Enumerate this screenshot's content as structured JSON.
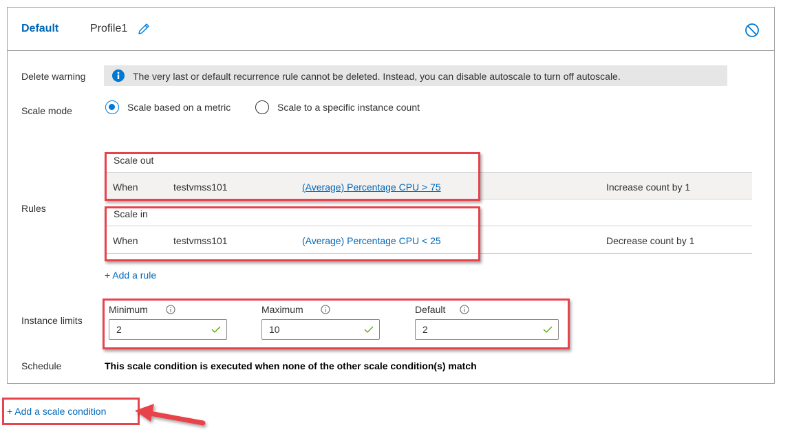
{
  "header": {
    "tab_default": "Default",
    "profile_name": "Profile1"
  },
  "delete_warning": {
    "label": "Delete warning",
    "message": "The very last or default recurrence rule cannot be deleted. Instead, you can disable autoscale to turn off autoscale."
  },
  "scale_mode": {
    "label": "Scale mode",
    "options": [
      {
        "label": "Scale based on a metric",
        "selected": true
      },
      {
        "label": "Scale to a specific instance count",
        "selected": false
      }
    ]
  },
  "rules": {
    "label": "Rules",
    "groups": [
      {
        "title": "Scale out",
        "when": "When",
        "resource": "testvmss101",
        "condition": "(Average) Percentage CPU > 75",
        "action": "Increase count by 1"
      },
      {
        "title": "Scale in",
        "when": "When",
        "resource": "testvmss101",
        "condition": "(Average) Percentage CPU < 25",
        "action": "Decrease count by 1"
      }
    ],
    "add_rule": "+ Add a rule"
  },
  "instance_limits": {
    "label": "Instance limits",
    "minimum": {
      "label": "Minimum",
      "value": "2"
    },
    "maximum": {
      "label": "Maximum",
      "value": "10"
    },
    "default": {
      "label": "Default",
      "value": "2"
    }
  },
  "schedule": {
    "label": "Schedule",
    "text": "This scale condition is executed when none of the other scale condition(s) match"
  },
  "add_scale_condition": "+ Add a scale condition",
  "colors": {
    "accent": "#0078d4",
    "link": "#0067b8",
    "highlight": "#e8434c",
    "valid_check": "#57a300"
  }
}
